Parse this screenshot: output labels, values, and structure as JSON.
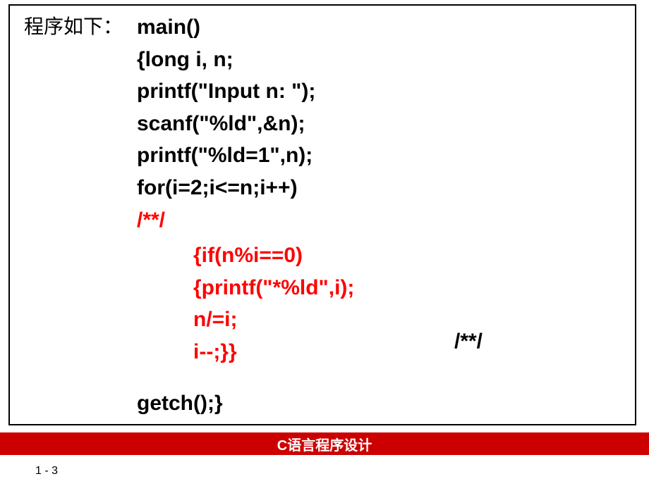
{
  "label": "程序如下：",
  "code": {
    "line1": "main()",
    "line2": "{long i, n;",
    "line3": "printf(\"Input n: \");",
    "line4": "scanf(\"%ld\",&n);",
    "line5": "printf(\"%ld=1\",n);",
    "line6": "for(i=2;i<=n;i++)",
    "comment1": "/**/",
    "red1": "{if(n%i==0)",
    "red2": "{printf(\"*%ld\",i);",
    "red3": "n/=i;",
    "red4": "i--;}}",
    "comment2": "/**/",
    "line7": "getch();}"
  },
  "footer": "C语言程序设计",
  "page_num": "1 - 3"
}
